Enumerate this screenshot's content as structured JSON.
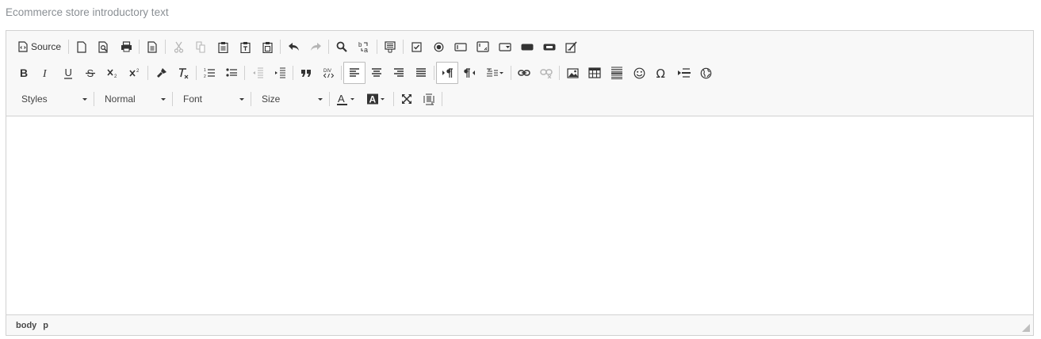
{
  "label": "Ecommerce store introductory text",
  "toolbar": {
    "source_label": "Source",
    "styles": "Styles",
    "format": "Normal",
    "font": "Font",
    "size": "Size"
  },
  "path": [
    "body",
    "p"
  ],
  "icons": [
    "source-icon",
    "new-page-icon",
    "preview-icon",
    "print-icon",
    "templates-icon",
    "cut-icon",
    "copy-icon",
    "paste-icon",
    "paste-text-icon",
    "paste-word-icon",
    "undo-icon",
    "redo-icon",
    "find-icon",
    "replace-icon",
    "select-all-icon",
    "checkbox-icon",
    "radio-icon",
    "text-field-icon",
    "textarea-icon",
    "select-icon",
    "button-icon",
    "image-button-icon",
    "hidden-field-icon",
    "bold-icon",
    "italic-icon",
    "underline-icon",
    "strike-icon",
    "subscript-icon",
    "superscript-icon",
    "copy-format-icon",
    "remove-format-icon",
    "numbered-list-icon",
    "bulleted-list-icon",
    "outdent-icon",
    "indent-icon",
    "blockquote-icon",
    "div-icon",
    "align-left-icon",
    "align-center-icon",
    "align-right-icon",
    "justify-icon",
    "ltr-icon",
    "rtl-icon",
    "language-icon",
    "link-icon",
    "unlink-icon",
    "image-icon",
    "table-icon",
    "horizontal-rule-icon",
    "smiley-icon",
    "special-char-icon",
    "page-break-icon",
    "iframe-icon",
    "text-color-icon",
    "bg-color-icon",
    "maximize-icon",
    "show-blocks-icon",
    "resize-icon"
  ]
}
